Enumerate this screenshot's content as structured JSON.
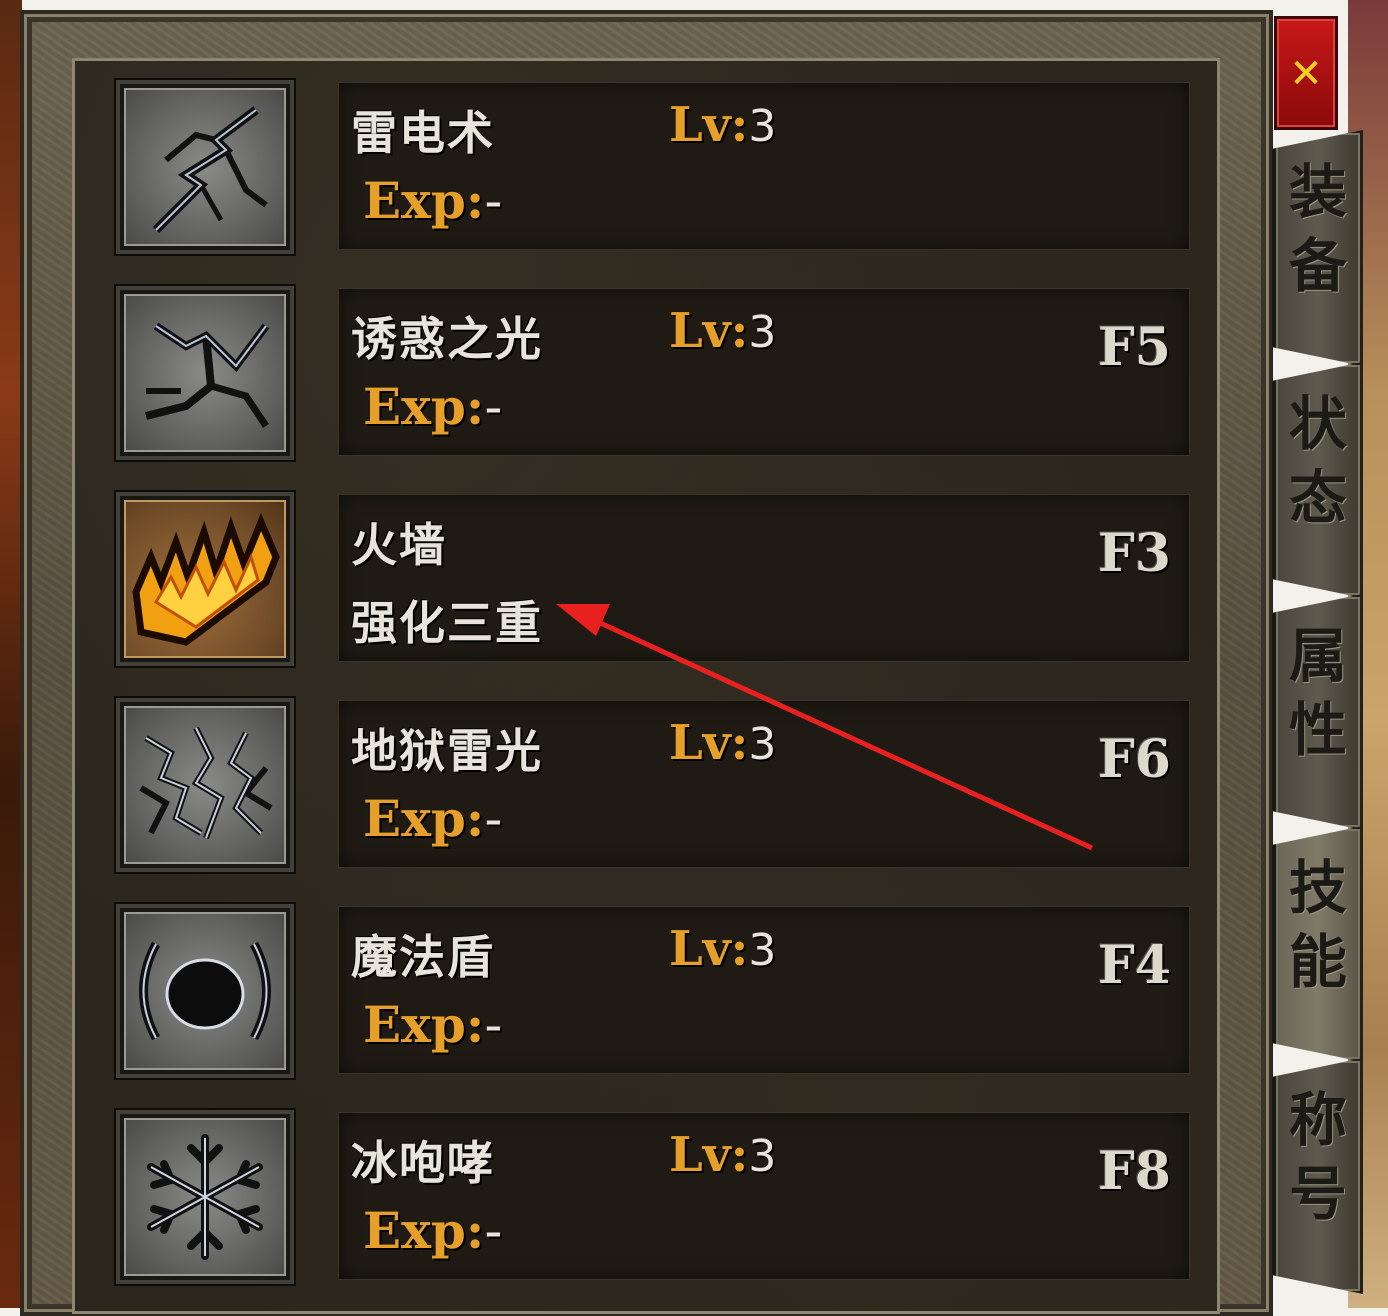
{
  "window": {
    "close_label": "✕"
  },
  "skills": [
    {
      "name": "雷电术",
      "lv_label": "Lv",
      "lv_sep": ":",
      "lv_value": "3",
      "exp_label": "Exp",
      "exp_sep": ":",
      "exp_value": "-",
      "hotkey": "",
      "icon": "lightning-bolt-icon"
    },
    {
      "name": "诱惑之光",
      "lv_label": "Lv",
      "lv_sep": ":",
      "lv_value": "3",
      "exp_label": "Exp",
      "exp_sep": ":",
      "exp_value": "-",
      "hotkey": "F5",
      "icon": "lure-light-icon"
    },
    {
      "name": "火墙",
      "enhancement": "强化三重",
      "hotkey": "F3",
      "icon": "fire-wall-icon"
    },
    {
      "name": "地狱雷光",
      "lv_label": "Lv",
      "lv_sep": ":",
      "lv_value": "3",
      "exp_label": "Exp",
      "exp_sep": ":",
      "exp_value": "-",
      "hotkey": "F6",
      "icon": "hell-thunder-icon"
    },
    {
      "name": "魔法盾",
      "lv_label": "Lv",
      "lv_sep": ":",
      "lv_value": "3",
      "exp_label": "Exp",
      "exp_sep": ":",
      "exp_value": "-",
      "hotkey": "F4",
      "icon": "magic-shield-icon"
    },
    {
      "name": "冰咆哮",
      "lv_label": "Lv",
      "lv_sep": ":",
      "lv_value": "3",
      "exp_label": "Exp",
      "exp_sep": ":",
      "exp_value": "-",
      "hotkey": "F8",
      "icon": "snowflake-icon"
    }
  ],
  "tabs": [
    {
      "label": "装备",
      "active": false
    },
    {
      "label": "状态",
      "active": false
    },
    {
      "label": "属性",
      "active": false
    },
    {
      "label": "技能",
      "active": true
    },
    {
      "label": "称号",
      "active": false
    }
  ],
  "colors": {
    "accent_gold": "#e6a02a",
    "annotation_red": "#e82020",
    "close_red": "#c81818"
  }
}
